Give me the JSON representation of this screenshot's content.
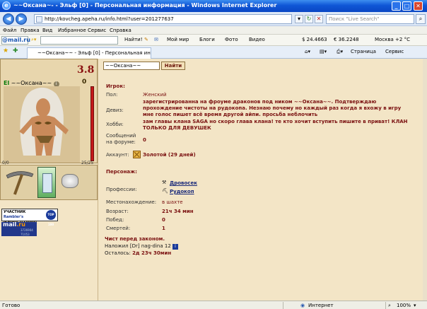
{
  "window": {
    "title": "~~Оксана~- - Эльф [0] - Персональная информация - Windows Internet Explorer",
    "min": "_",
    "max": "□",
    "close": "✕"
  },
  "address": {
    "url": "http://kovcheg.apeha.ru/info.html?user=201277637",
    "search_placeholder": "Поиск \"Live Search\""
  },
  "menu": [
    "Файл",
    "Правка",
    "Вид",
    "Избранное",
    "Сервис",
    "Справка"
  ],
  "mailbar": {
    "logo": "@mail.ru",
    "find_label": "Найти!",
    "items": [
      "Мой мир",
      "Блоги",
      "Фото",
      "Видео"
    ],
    "usd": "$ 24.4663",
    "eur": "€ 36.2248",
    "weather": "Москва +2 °С"
  },
  "tabbar": {
    "tab_title": "~~Оксана~~ - Эльф [0] - Персональная информация",
    "page_menu": "Страница",
    "tools_menu": "Сервис"
  },
  "character": {
    "level": "3.8",
    "race_tag": "El",
    "name": "~~Оксана~~",
    "info_icon": "i",
    "zero": "0",
    "hp_left": "0/0",
    "hp_right": "25/25"
  },
  "badges": {
    "participant": "УЧАСТНИК",
    "rambler": "Rambler's",
    "top": "TOP 100",
    "rating": "РЕЙТИНГ 214759041",
    "mailru_mail": "mail",
    "mailru_ru": ".ru",
    "counts": "3726904\n71053"
  },
  "search": {
    "nick_value": "~~Оксана~~",
    "find_button": "Найти"
  },
  "player": {
    "header": "Игрок:",
    "gender_label": "Пол:",
    "gender_value": "Женский",
    "motto_label": "Девиз:",
    "motto_value": "зарегистрированна на фроуме драконов под ником ~~Оксана~~. Подтверждаю прохождение чистоты на рудокопа. Незнаю почему но каждый раз когда я вхожу в игру мне голос пишет всё время другой айпи. просьба неблочить",
    "hobby_label": "Хобби:",
    "hobby_value": "зам главы клана SAGA но скоро глава клана! те кто хочит вступить пишите в приват! КЛАН ТОЛЬКО ДЛЯ ДЕВУШЕК",
    "forum_label": "Сообщений на форуме:",
    "forum_value": "0",
    "account_label": "Аккаунт:",
    "account_value": "Золотой (29 дней)"
  },
  "character_info": {
    "header": "Персонаж:",
    "professions_label": "Профессии:",
    "professions": [
      "Дровосек",
      "Рудокоп"
    ],
    "location_label": "Местонахождение:",
    "location_value": "в шахте",
    "age_label": "Возраст:",
    "age_value": "21ч 34 мин",
    "wins_label": "Побед:",
    "wins_value": "0",
    "deaths_label": "Смертей:",
    "deaths_value": "1"
  },
  "law": {
    "clean": "Чист перед законом.",
    "imposed_prefix": "Наложил",
    "imposed_by": "[Dr] nag-dina 12",
    "remaining_label": "Осталось:",
    "remaining_value": "2д 23ч 30мин"
  },
  "status": {
    "left": "Готово",
    "zone": "Интернет",
    "zoom": "100%"
  }
}
